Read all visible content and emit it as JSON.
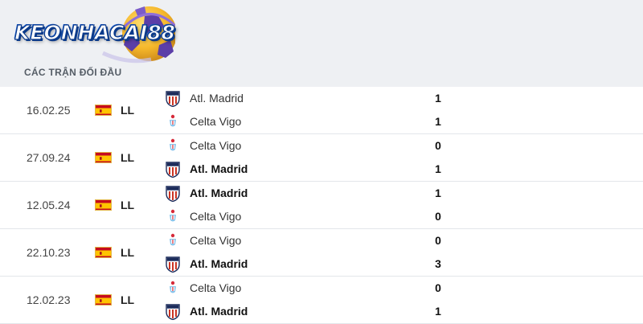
{
  "brand": {
    "logo_text": "KEONHACAI88"
  },
  "section_title": "CÁC TRẬN ĐỐI ĐẦU",
  "matches": [
    {
      "date": "16.02.25",
      "league": "LL",
      "teams": [
        {
          "name": "Atl. Madrid",
          "score": "1",
          "crest": "atletico-crest",
          "winner": false
        },
        {
          "name": "Celta Vigo",
          "score": "1",
          "crest": "celta-crest",
          "winner": false
        }
      ]
    },
    {
      "date": "27.09.24",
      "league": "LL",
      "teams": [
        {
          "name": "Celta Vigo",
          "score": "0",
          "crest": "celta-crest",
          "winner": false
        },
        {
          "name": "Atl. Madrid",
          "score": "1",
          "crest": "atletico-crest",
          "winner": true
        }
      ]
    },
    {
      "date": "12.05.24",
      "league": "LL",
      "teams": [
        {
          "name": "Atl. Madrid",
          "score": "1",
          "crest": "atletico-crest",
          "winner": true
        },
        {
          "name": "Celta Vigo",
          "score": "0",
          "crest": "celta-crest",
          "winner": false
        }
      ]
    },
    {
      "date": "22.10.23",
      "league": "LL",
      "teams": [
        {
          "name": "Celta Vigo",
          "score": "0",
          "crest": "celta-crest",
          "winner": false
        },
        {
          "name": "Atl. Madrid",
          "score": "3",
          "crest": "atletico-crest",
          "winner": true
        }
      ]
    },
    {
      "date": "12.02.23",
      "league": "LL",
      "teams": [
        {
          "name": "Celta Vigo",
          "score": "0",
          "crest": "celta-crest",
          "winner": false
        },
        {
          "name": "Atl. Madrid",
          "score": "1",
          "crest": "atletico-crest",
          "winner": true
        }
      ]
    }
  ]
}
